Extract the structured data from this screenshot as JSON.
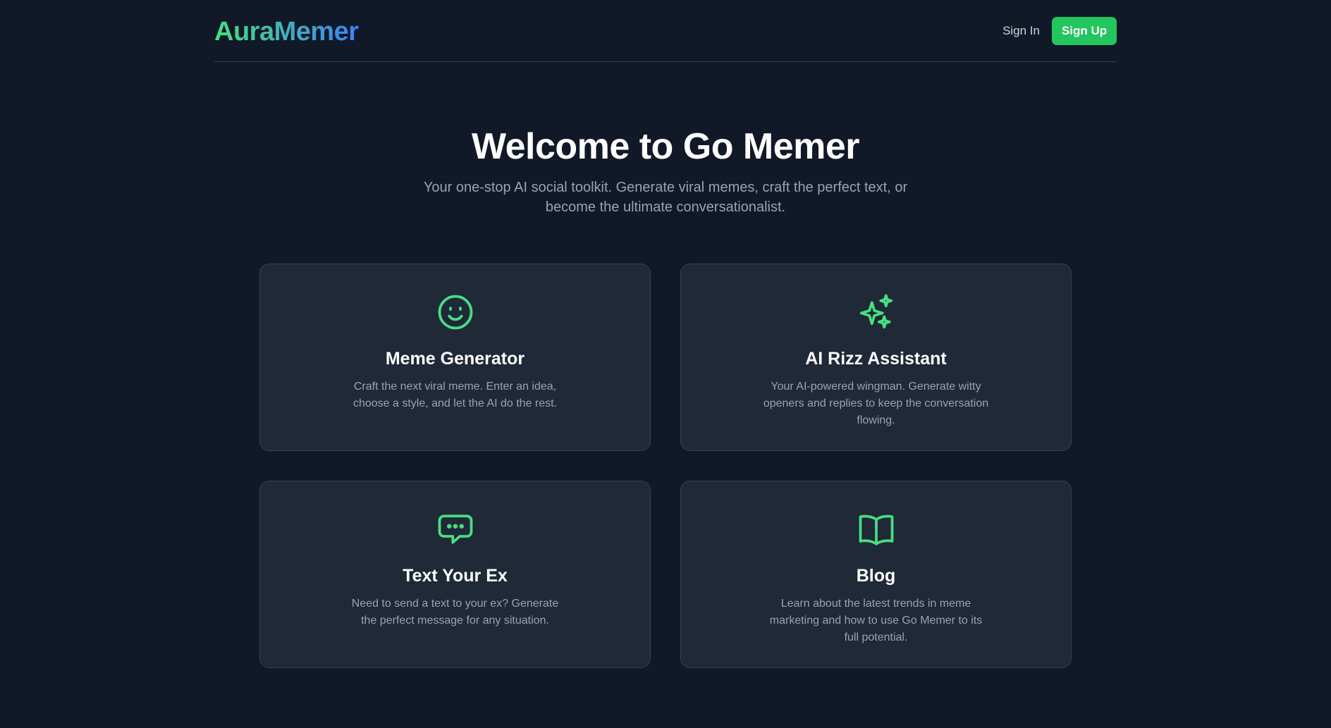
{
  "header": {
    "logo": "AuraMemer",
    "sign_in": "Sign In",
    "sign_up": "Sign Up"
  },
  "hero": {
    "title": "Welcome to Go Memer",
    "subtitle": "Your one-stop AI social toolkit. Generate viral memes, craft the perfect text, or become the ultimate conversationalist."
  },
  "features": [
    {
      "icon": "smile-icon",
      "title": "Meme Generator",
      "description": "Craft the next viral meme. Enter an idea, choose a style, and let the AI do the rest."
    },
    {
      "icon": "sparkles-icon",
      "title": "AI Rizz Assistant",
      "description": "Your AI-powered wingman. Generate witty openers and replies to keep the conversation flowing."
    },
    {
      "icon": "chat-bubble-icon",
      "title": "Text Your Ex",
      "description": "Need to send a text to your ex? Generate the perfect message for any situation."
    },
    {
      "icon": "book-open-icon",
      "title": "Blog",
      "description": "Learn about the latest trends in meme marketing and how to use Go Memer to its full potential."
    }
  ],
  "colors": {
    "background": "#111827",
    "card": "#1f2937",
    "accent": "#22c55e",
    "icon": "#4ade80",
    "logo_gradient_end": "#3b82f6"
  }
}
